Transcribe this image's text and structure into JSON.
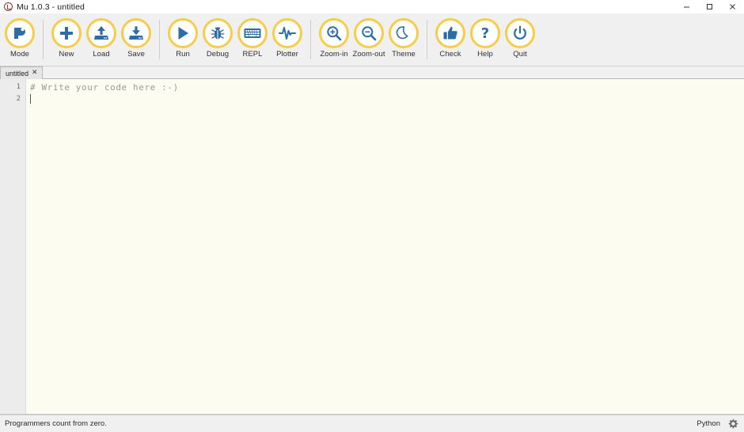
{
  "window": {
    "title": "Mu 1.0.3 - untitled",
    "logo_icon": "mu-logo-icon",
    "controls": [
      {
        "name": "minimize-button",
        "icon": "minimize-icon"
      },
      {
        "name": "maximize-button",
        "icon": "maximize-icon"
      },
      {
        "name": "close-button",
        "icon": "close-icon"
      }
    ]
  },
  "toolbar": {
    "groups": [
      {
        "items": [
          {
            "label": "Mode",
            "icon": "mode-icon"
          }
        ]
      },
      {
        "items": [
          {
            "label": "New",
            "icon": "plus-icon"
          },
          {
            "label": "Load",
            "icon": "upload-icon"
          },
          {
            "label": "Save",
            "icon": "download-icon"
          }
        ]
      },
      {
        "items": [
          {
            "label": "Run",
            "icon": "play-icon"
          },
          {
            "label": "Debug",
            "icon": "bug-icon"
          },
          {
            "label": "REPL",
            "icon": "keyboard-icon"
          },
          {
            "label": "Plotter",
            "icon": "waveform-icon"
          }
        ]
      },
      {
        "items": [
          {
            "label": "Zoom-in",
            "icon": "magnifier-plus-icon"
          },
          {
            "label": "Zoom-out",
            "icon": "magnifier-minus-icon"
          },
          {
            "label": "Theme",
            "icon": "moon-icon"
          }
        ]
      },
      {
        "items": [
          {
            "label": "Check",
            "icon": "thumbs-up-icon"
          },
          {
            "label": "Help",
            "icon": "question-mark-icon"
          },
          {
            "label": "Quit",
            "icon": "power-icon"
          }
        ]
      }
    ]
  },
  "tabs": [
    {
      "label": "untitled",
      "close_glyph": "✕"
    }
  ],
  "editor": {
    "line_numbers": [
      "1",
      "2"
    ],
    "lines": [
      {
        "text": "# Write your code here :-)",
        "style": "comment"
      },
      {
        "text": "",
        "style": "plain"
      }
    ]
  },
  "statusbar": {
    "message": "Programmers count from zero.",
    "mode": "Python",
    "gear_icon": "gear-icon"
  },
  "colors": {
    "ring": "#f7cc48",
    "icon_blue": "#2b6da4",
    "editor_bg": "#fdfcf0",
    "chrome": "#f0f0f0",
    "comment": "#9a9a9a"
  }
}
